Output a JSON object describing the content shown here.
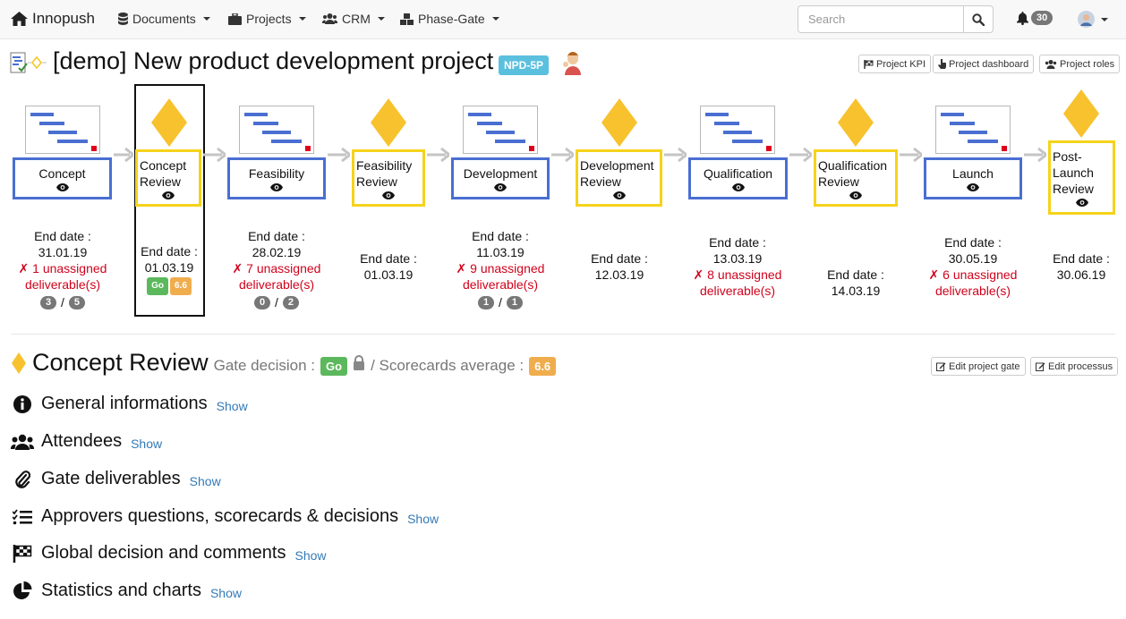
{
  "nav": {
    "brand": "Innopush",
    "items": [
      {
        "label": "Documents"
      },
      {
        "label": "Projects"
      },
      {
        "label": "CRM"
      },
      {
        "label": "Phase-Gate"
      }
    ],
    "search_placeholder": "Search",
    "notifications": "30"
  },
  "header": {
    "title": "[demo] New product development project",
    "code": "NPD-5P",
    "buttons": [
      "Project KPI",
      "Project dashboard",
      "Project roles"
    ]
  },
  "process": {
    "stages": [
      {
        "kind": "stage",
        "name": "Concept",
        "end_label": "End date :",
        "end_date": "31.01.19",
        "unassigned": "✗ 1 unassigned deliverable(s)",
        "done": "3",
        "total": "5"
      },
      {
        "kind": "gate",
        "name": "Concept Review",
        "end_label": "End date :",
        "end_date": "01.03.19",
        "decision": "Go",
        "score": "6.6"
      },
      {
        "kind": "stage",
        "name": "Feasibility",
        "end_label": "End date :",
        "end_date": "28.02.19",
        "unassigned": "✗ 7 unassigned deliverable(s)",
        "done": "0",
        "total": "2"
      },
      {
        "kind": "gate",
        "name": "Feasibility Review",
        "end_label": "End date :",
        "end_date": "01.03.19"
      },
      {
        "kind": "stage",
        "name": "Development",
        "end_label": "End date :",
        "end_date": "11.03.19",
        "unassigned": "✗ 9 unassigned deliverable(s)",
        "done": "1",
        "total": "1"
      },
      {
        "kind": "gate",
        "name": "Development Review",
        "end_label": "End date :",
        "end_date": "12.03.19"
      },
      {
        "kind": "stage",
        "name": "Qualification",
        "end_label": "End date :",
        "end_date": "13.03.19",
        "unassigned": "✗ 8 unassigned deliverable(s)"
      },
      {
        "kind": "gate",
        "name": "Qualification Review",
        "end_label": "End date :",
        "end_date": "14.03.19"
      },
      {
        "kind": "stage",
        "name": "Launch",
        "end_label": "End date :",
        "end_date": "30.05.19",
        "unassigned": "✗ 6 unassigned deliverable(s)"
      },
      {
        "kind": "gate",
        "name": "Post-Launch Review",
        "end_label": "End date :",
        "end_date": "30.06.19"
      }
    ]
  },
  "section": {
    "title": "Concept Review",
    "gate_decision_label": "Gate decision :",
    "gate_decision": "Go",
    "scorecards_label": "/ Scorecards average :",
    "scorecards_average": "6.6",
    "buttons": [
      "Edit project gate",
      "Edit processus"
    ],
    "rows": [
      {
        "label": "General informations",
        "action": "Show",
        "icon": "info-icon"
      },
      {
        "label": "Attendees",
        "action": "Show",
        "icon": "users-icon"
      },
      {
        "label": "Gate deliverables",
        "action": "Show",
        "icon": "paperclip-icon"
      },
      {
        "label": "Approvers questions, scorecards & decisions",
        "action": "Show",
        "icon": "checklist-icon"
      },
      {
        "label": "Global decision and comments",
        "action": "Show",
        "icon": "checkered-flag-icon"
      },
      {
        "label": "Statistics and charts",
        "action": "Show",
        "icon": "pie-chart-icon"
      }
    ]
  },
  "colors": {
    "stage_border": "#4a6fd1",
    "gate_border": "#f5d31b",
    "gate_diamond": "#f7c22e",
    "unassigned_text": "#d0021b",
    "go": "#5cb85c",
    "score": "#f0ad4e",
    "code_badge": "#5bc0de",
    "show_link": "#337ab7"
  }
}
